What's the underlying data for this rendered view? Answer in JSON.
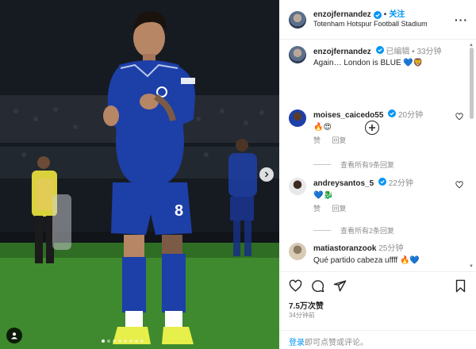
{
  "post": {
    "username": "enzojfernandez",
    "follow_label": "关注",
    "separator": "•",
    "location": "Totenham Hotspur Football Stadium",
    "more_label": "···"
  },
  "caption": {
    "username": "enzojfernandez",
    "edited": "已编辑",
    "separator": "•",
    "time": "33分钟",
    "text": "Again… London is BLUE",
    "emoji": "💙🦁"
  },
  "comments": [
    {
      "username": "moises_caicedo55",
      "verified": true,
      "time": "20分钟",
      "text": "🔥😍",
      "like_label": "赞",
      "reply_label": "回复",
      "view_replies": "查看所有9条回复"
    },
    {
      "username": "andreysantos_5",
      "verified": true,
      "time": "22分钟",
      "text": "💙🐉",
      "like_label": "赞",
      "reply_label": "回复",
      "view_replies": "查看所有2条回复"
    },
    {
      "username": "matiastoranzook",
      "verified": false,
      "time": "25分钟",
      "text": "Qué partido cabeza uffff 🔥💙"
    }
  ],
  "actions": {
    "likes": "7.5万次赞",
    "time_ago": "34分钟前"
  },
  "login": {
    "link": "登录",
    "rest": "即可点赞或评论。"
  },
  "media": {
    "shirt_number": "8",
    "carousel_count": 8,
    "carousel_active": 0
  },
  "colors": {
    "chelsea_blue": "#1d3fa8",
    "instagram_link": "#0095f6",
    "verified_blue": "#0095f6",
    "pitch_green": "#3f8a2e"
  }
}
